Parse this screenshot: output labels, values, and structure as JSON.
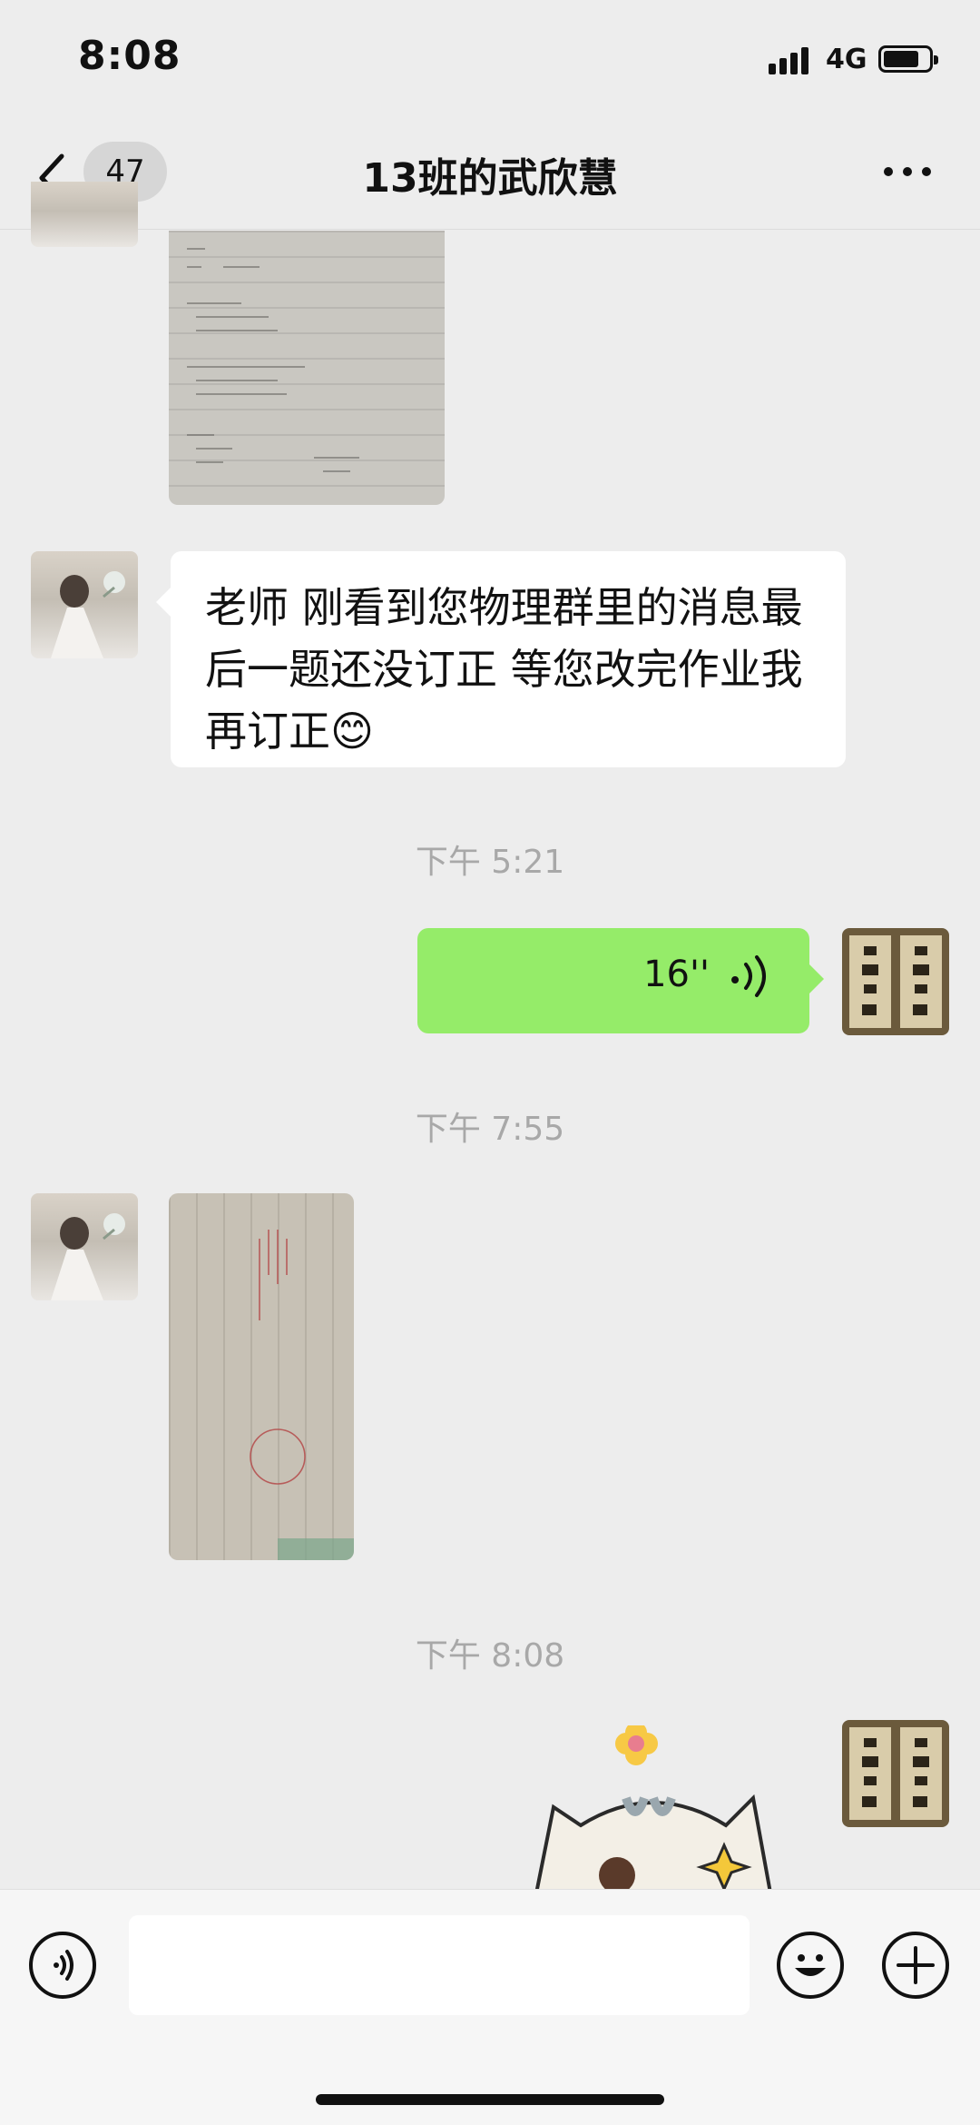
{
  "status": {
    "time": "8:08",
    "network": "4G"
  },
  "nav": {
    "unread_count": "47",
    "title": "13班的武欣慧"
  },
  "messages": {
    "text_in": "老师 刚看到您物理群里的消息最后一题还没订正 等您改完作业我再订正😊",
    "voice_duration": "16''"
  },
  "timestamps": {
    "t1": "下午 5:21",
    "t2": "下午 7:55",
    "t3": "下午 8:08"
  },
  "input": {
    "placeholder": ""
  },
  "colors": {
    "sent_bubble": "#95ec69",
    "received_bubble": "#ffffff",
    "background": "#ededed"
  },
  "icons": [
    "chevron-left-icon",
    "more-icon",
    "voice-icon",
    "voice-wave-icon",
    "emoji-icon",
    "plus-icon"
  ]
}
